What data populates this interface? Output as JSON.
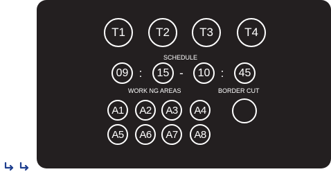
{
  "timers": {
    "t1_label": "T1",
    "t2_label": "T2",
    "t3_label": "T3",
    "t4_label": "T4"
  },
  "schedule": {
    "title": "SCHEDULE",
    "start_hour": "09",
    "start_minute": "15",
    "end_hour": "10",
    "end_minute": "45",
    "time_separator": ":",
    "range_separator": "-"
  },
  "work_areas": {
    "title": "WORK NG AREAS",
    "a1_label": "A1",
    "a2_label": "A2",
    "a3_label": "A3",
    "a4_label": "A4",
    "a5_label": "A5",
    "a6_label": "A6",
    "a7_label": "A7",
    "a8_label": "A8"
  },
  "border_cut": {
    "title": "BORDER CUT"
  },
  "colors": {
    "panel": "#231f20",
    "foreground": "#ffffff",
    "arrow_icons": "#1f3f8f"
  }
}
